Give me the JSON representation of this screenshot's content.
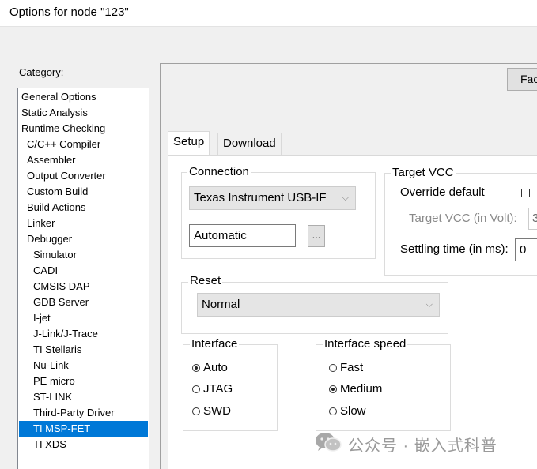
{
  "window": {
    "title": "Options for node \"123\""
  },
  "category": {
    "label": "Category:",
    "items": [
      {
        "label": "General Options",
        "level": 0
      },
      {
        "label": "Static Analysis",
        "level": 0
      },
      {
        "label": "Runtime Checking",
        "level": 0
      },
      {
        "label": "C/C++ Compiler",
        "level": 1
      },
      {
        "label": "Assembler",
        "level": 1
      },
      {
        "label": "Output Converter",
        "level": 1
      },
      {
        "label": "Custom Build",
        "level": 1
      },
      {
        "label": "Build Actions",
        "level": 1
      },
      {
        "label": "Linker",
        "level": 1
      },
      {
        "label": "Debugger",
        "level": 1
      },
      {
        "label": "Simulator",
        "level": 2
      },
      {
        "label": "CADI",
        "level": 2
      },
      {
        "label": "CMSIS DAP",
        "level": 2
      },
      {
        "label": "GDB Server",
        "level": 2
      },
      {
        "label": "I-jet",
        "level": 2
      },
      {
        "label": "J-Link/J-Trace",
        "level": 2
      },
      {
        "label": "TI Stellaris",
        "level": 2
      },
      {
        "label": "Nu-Link",
        "level": 2
      },
      {
        "label": "PE micro",
        "level": 2
      },
      {
        "label": "ST-LINK",
        "level": 2
      },
      {
        "label": "Third-Party Driver",
        "level": 2
      },
      {
        "label": "TI MSP-FET",
        "level": 2,
        "selected": true
      },
      {
        "label": "TI XDS",
        "level": 2
      }
    ]
  },
  "factory_button": {
    "label": "Fac"
  },
  "tabs": [
    {
      "label": "Setup",
      "active": true
    },
    {
      "label": "Download",
      "active": false
    }
  ],
  "connection": {
    "title": "Connection",
    "selected": "Texas Instrument USB-IF",
    "port_value": "Automatic",
    "browse_label": "..."
  },
  "target_vcc": {
    "title": "Target VCC",
    "override_label": "Override default",
    "override_checked": false,
    "vcc_label": "Target VCC (in Volt):",
    "vcc_value": "3",
    "settling_label": "Settling time (in ms):",
    "settling_value": "0"
  },
  "reset": {
    "title": "Reset",
    "selected": "Normal"
  },
  "interface": {
    "title": "Interface",
    "options": [
      {
        "label": "Auto",
        "checked": true
      },
      {
        "label": "JTAG",
        "checked": false
      },
      {
        "label": "SWD",
        "checked": false
      }
    ]
  },
  "interface_speed": {
    "title": "Interface speed",
    "options": [
      {
        "label": "Fast",
        "checked": false
      },
      {
        "label": "Medium",
        "checked": true
      },
      {
        "label": "Slow",
        "checked": false
      }
    ]
  },
  "watermark": {
    "text": "公众号 · 嵌入式科普",
    "icon": "wechat-icon"
  }
}
